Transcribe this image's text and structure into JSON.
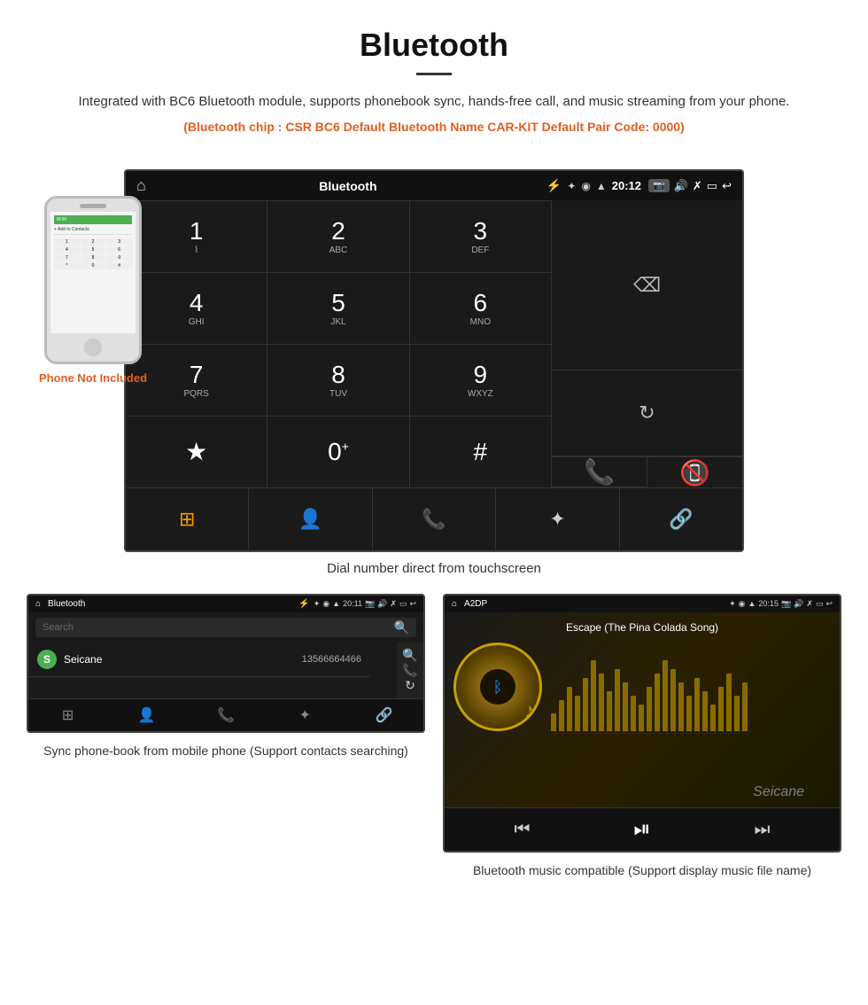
{
  "header": {
    "title": "Bluetooth",
    "description": "Integrated with BC6 Bluetooth module, supports phonebook sync, hands-free call, and music streaming from your phone.",
    "specs": "(Bluetooth chip : CSR BC6    Default Bluetooth Name CAR-KIT    Default Pair Code: 0000)"
  },
  "main_screen": {
    "statusbar": {
      "home_icon": "⌂",
      "title": "Bluetooth",
      "usb_icon": "⚡",
      "bluetooth_icon": "✦",
      "location_icon": "◉",
      "signal_icon": "▲",
      "time": "20:12",
      "camera_icon": "📷",
      "volume_icon": "🔊",
      "x_icon": "✗",
      "rect_icon": "▭",
      "back_icon": "↩"
    },
    "dialpad": {
      "keys": [
        {
          "num": "1",
          "letters": "⌇",
          "sub": ""
        },
        {
          "num": "2",
          "letters": "ABC",
          "sub": ""
        },
        {
          "num": "3",
          "letters": "DEF",
          "sub": ""
        },
        {
          "num": "4",
          "letters": "GHI",
          "sub": ""
        },
        {
          "num": "5",
          "letters": "JKL",
          "sub": ""
        },
        {
          "num": "6",
          "letters": "MNO",
          "sub": ""
        },
        {
          "num": "7",
          "letters": "PQRS",
          "sub": ""
        },
        {
          "num": "8",
          "letters": "TUV",
          "sub": ""
        },
        {
          "num": "9",
          "letters": "WXYZ",
          "sub": ""
        },
        {
          "num": "★",
          "letters": "",
          "sub": ""
        },
        {
          "num": "0",
          "letters": "+",
          "sub": ""
        },
        {
          "num": "#",
          "letters": "",
          "sub": ""
        }
      ],
      "side_buttons": [
        {
          "type": "backspace",
          "icon": "⌫"
        },
        {
          "type": "empty",
          "icon": ""
        },
        {
          "type": "refresh",
          "icon": "↻"
        },
        {
          "type": "call-green",
          "icon": "📞"
        },
        {
          "type": "call-red",
          "icon": "📵"
        }
      ]
    },
    "bottom_buttons": [
      {
        "icon": "⊞",
        "label": "dialpad"
      },
      {
        "icon": "👤",
        "label": "contacts"
      },
      {
        "icon": "📞",
        "label": "phone"
      },
      {
        "icon": "✦",
        "label": "bluetooth"
      },
      {
        "icon": "🔗",
        "label": "link"
      }
    ]
  },
  "main_caption": "Dial number direct from touchscreen",
  "phone_aside": {
    "not_included_text": "Phone Not Included"
  },
  "phonebook_screen": {
    "title": "Bluetooth",
    "time": "20:11",
    "search_placeholder": "Search",
    "contact": {
      "initial": "S",
      "name": "Seicane",
      "number": "13566664466"
    },
    "bottom_buttons": [
      {
        "icon": "⊞"
      },
      {
        "icon": "👤",
        "highlight": true
      },
      {
        "icon": "📞"
      },
      {
        "icon": "✦"
      },
      {
        "icon": "🔗"
      }
    ]
  },
  "music_screen": {
    "title": "A2DP",
    "time": "20:15",
    "song_title": "Escape (The Pina Colada Song)",
    "controls": [
      {
        "icon": "⏮",
        "type": "prev"
      },
      {
        "icon": "⏯",
        "type": "play-pause"
      },
      {
        "icon": "⏭",
        "type": "next"
      }
    ]
  },
  "captions": {
    "phonebook": "Sync phone-book from mobile phone\n(Support contacts searching)",
    "music": "Bluetooth music compatible\n(Support display music file name)"
  },
  "visualizer_bars": [
    20,
    35,
    50,
    40,
    60,
    80,
    65,
    45,
    70,
    55,
    40,
    30,
    50,
    65,
    80,
    70,
    55,
    40,
    60,
    45,
    30,
    50,
    65,
    40,
    55
  ]
}
